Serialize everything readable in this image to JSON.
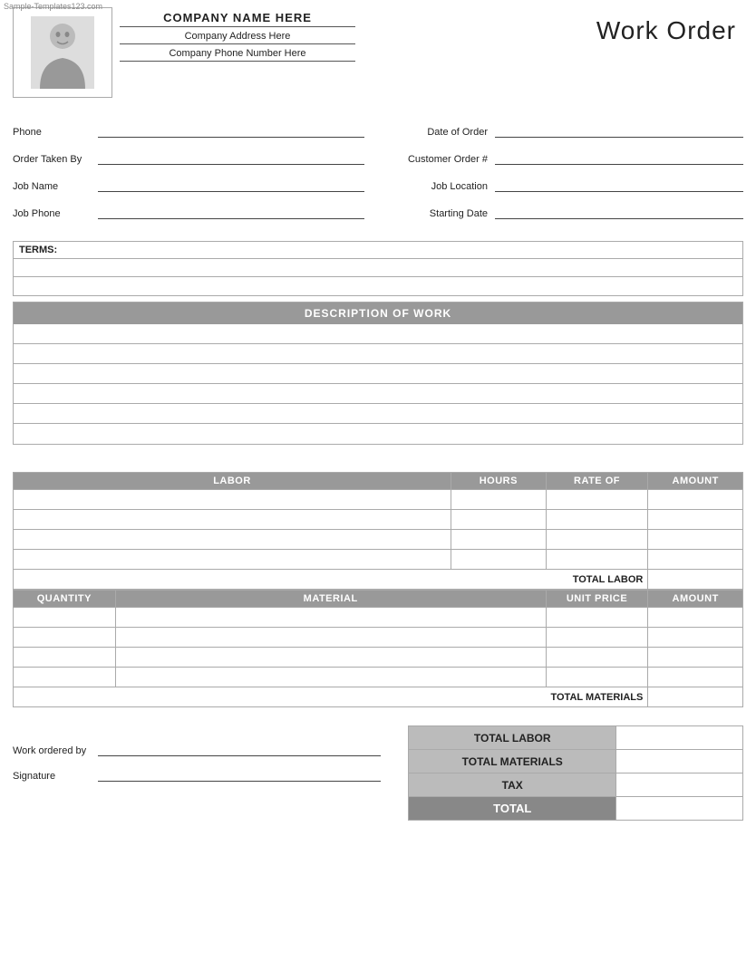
{
  "watermark": "Sample-Templates123.com",
  "header": {
    "company_name": "COMPANY NAME HERE",
    "company_address": "Company Address Here",
    "company_phone": "Company Phone Number Here",
    "title": "Work Order"
  },
  "fields": {
    "left": [
      {
        "label": "Phone",
        "value": ""
      },
      {
        "label": "Order Taken By",
        "value": ""
      },
      {
        "label": "Job Name",
        "value": ""
      },
      {
        "label": "Job Phone",
        "value": ""
      }
    ],
    "right": [
      {
        "label": "Date of Order",
        "value": ""
      },
      {
        "label": "Customer Order #",
        "value": ""
      },
      {
        "label": "Job Location",
        "value": ""
      },
      {
        "label": "Starting Date",
        "value": ""
      }
    ]
  },
  "terms": {
    "label": "TERMS:",
    "rows": 2
  },
  "description": {
    "header": "DESCRIPTION OF WORK",
    "rows": 6
  },
  "labor": {
    "columns": [
      "LABOR",
      "HOURS",
      "RATE OF",
      "AMOUNT"
    ],
    "rows": 4,
    "total_label": "TOTAL LABOR"
  },
  "material": {
    "columns": [
      "QUANTITY",
      "MATERIAL",
      "UNIT PRICE",
      "AMOUNT"
    ],
    "rows": 4,
    "total_label": "TOTAL MATERIALS"
  },
  "summary": {
    "rows": [
      {
        "label": "TOTAL LABOR",
        "value": ""
      },
      {
        "label": "TOTAL MATERIALS",
        "value": ""
      },
      {
        "label": "TAX",
        "value": ""
      },
      {
        "label": "TOTAL",
        "value": "",
        "is_total": true
      }
    ]
  },
  "bottom_fields": [
    {
      "label": "Work ordered by",
      "value": ""
    },
    {
      "label": "Signature",
      "value": ""
    }
  ]
}
